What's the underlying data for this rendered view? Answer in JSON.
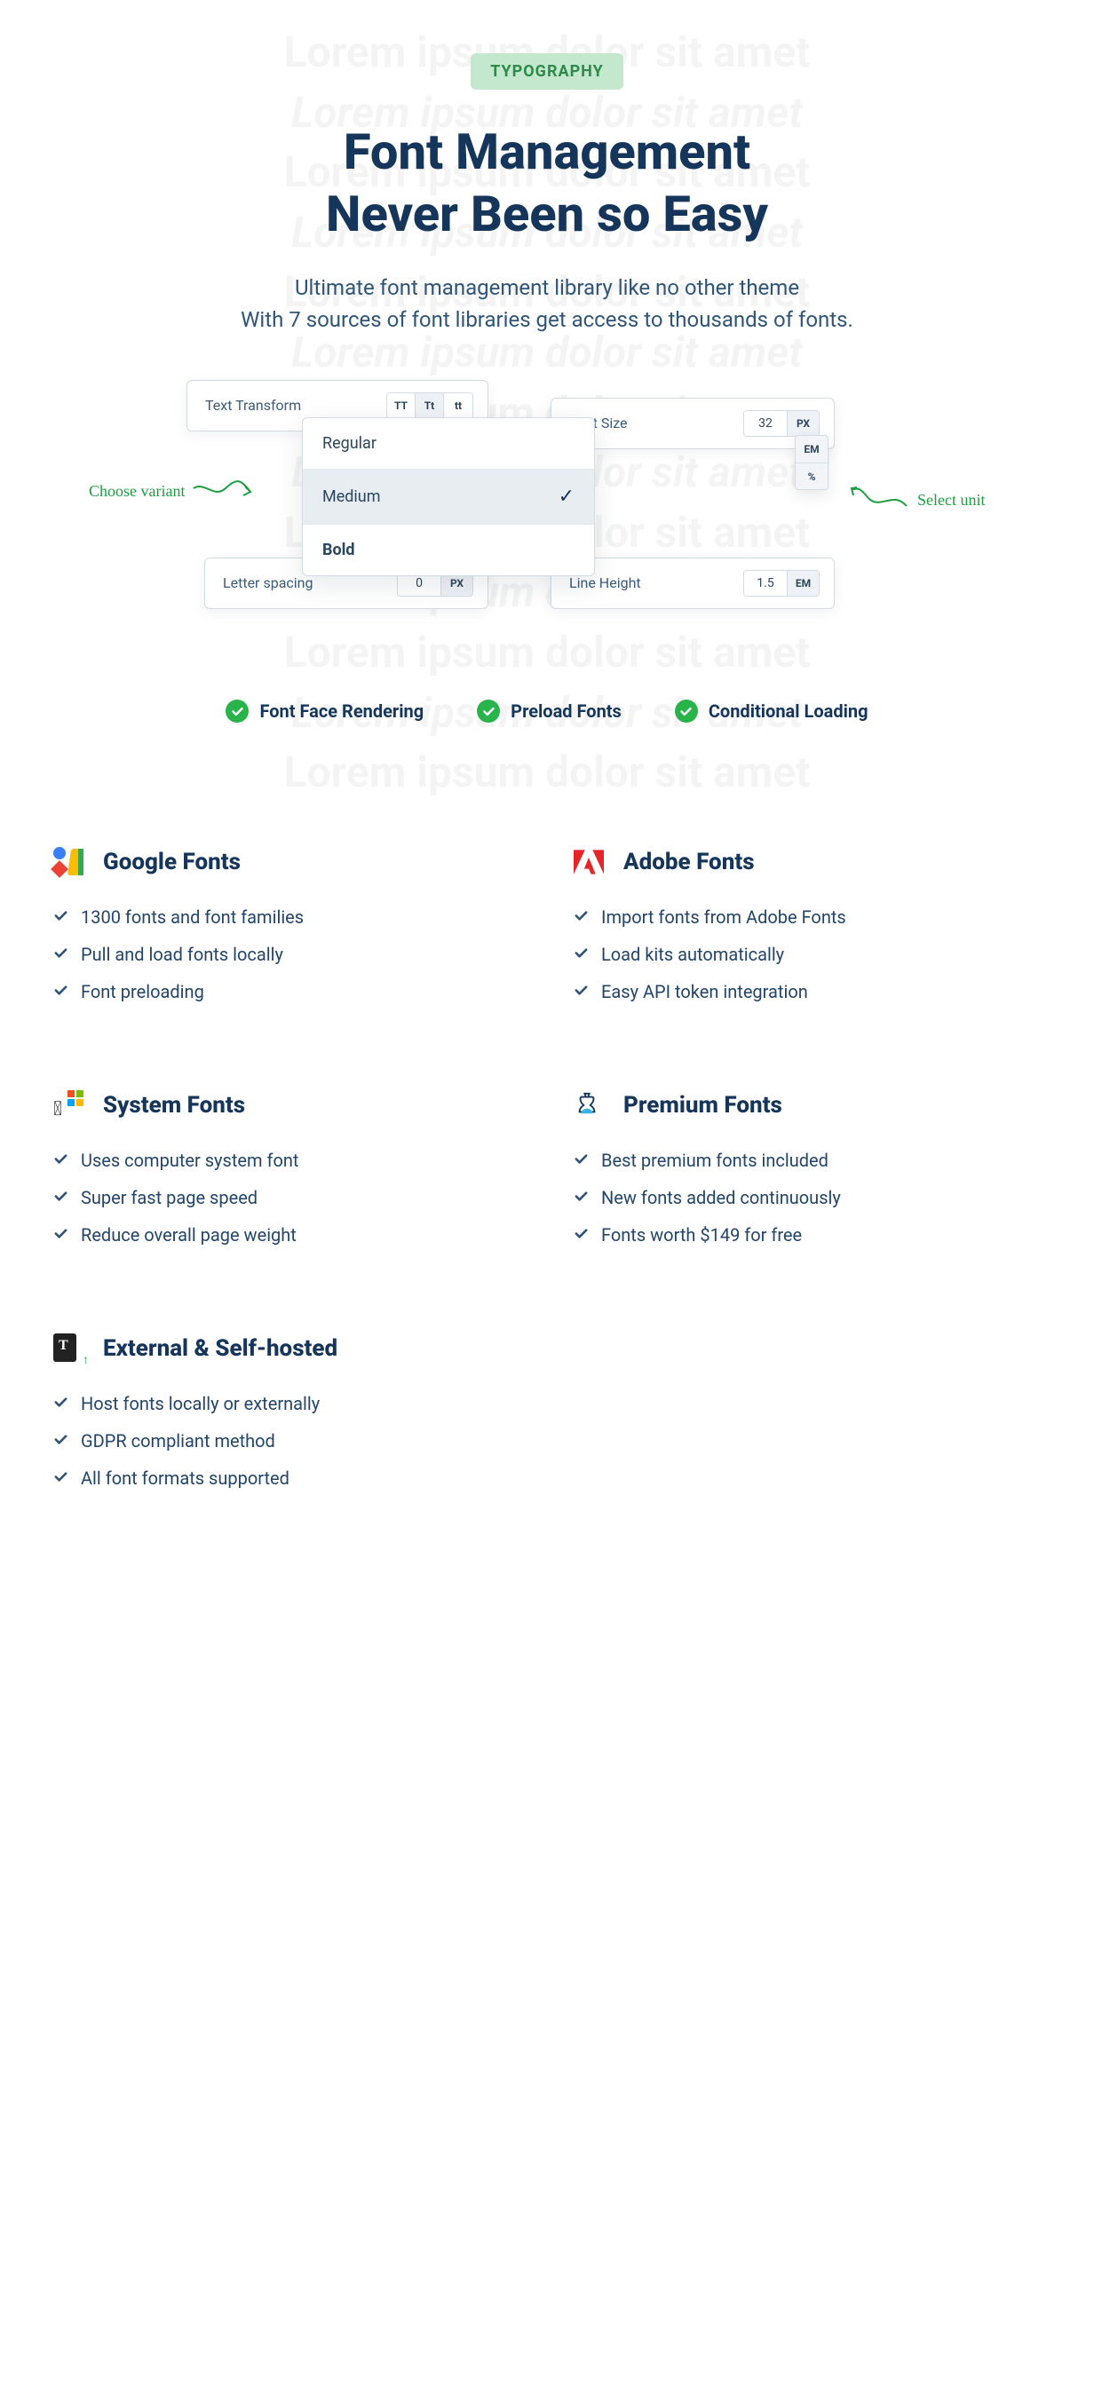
{
  "badge": "TYPOGRAPHY",
  "heading": {
    "line1": "Font Management",
    "line2": "Never Been so Easy"
  },
  "subtitle": {
    "line1": "Ultimate font management library like no other theme",
    "line2": "With 7 sources of font libraries get access to thousands of fonts."
  },
  "bg_text": "Lorem ipsum dolor sit amet",
  "textTransform": {
    "label": "Text Transform",
    "opts": [
      "TT",
      "Tt",
      "tt"
    ],
    "active": 1
  },
  "dropdown": {
    "options": [
      "Regular",
      "Medium",
      "Bold"
    ],
    "selected": 1
  },
  "fontSize": {
    "label": "Font Size",
    "value": "32",
    "unit": "PX",
    "unit_options": [
      "EM",
      "%"
    ]
  },
  "letterSpacing": {
    "label": "Letter spacing",
    "value": "0",
    "unit": "PX"
  },
  "lineHeight": {
    "label": "Line Height",
    "value": "1.5",
    "unit": "EM"
  },
  "annoLeft": "Choose variant",
  "annoRight": "Select unit",
  "featurePills": [
    "Font Face Rendering",
    "Preload Fonts",
    "Conditional Loading"
  ],
  "sources": [
    {
      "title": "Google Fonts",
      "icon": "google",
      "items": [
        "1300 fonts and font families",
        "Pull and load  fonts locally",
        "Font preloading"
      ]
    },
    {
      "title": "Adobe Fonts",
      "icon": "adobe",
      "items": [
        "Import fonts from Adobe Fonts",
        "Load kits automatically",
        "Easy API token integration"
      ]
    },
    {
      "title": "System Fonts",
      "icon": "system",
      "items": [
        "Uses computer system font",
        "Super fast page speed",
        "Reduce overall page weight"
      ]
    },
    {
      "title": "Premium Fonts",
      "icon": "premium",
      "items": [
        "Best premium fonts included",
        "New fonts added continuously",
        "Fonts worth $149 for free"
      ]
    },
    {
      "title": "External & Self-hosted",
      "icon": "external",
      "items": [
        "Host fonts locally or externally",
        "GDPR compliant method",
        "All font formats supported"
      ]
    }
  ]
}
